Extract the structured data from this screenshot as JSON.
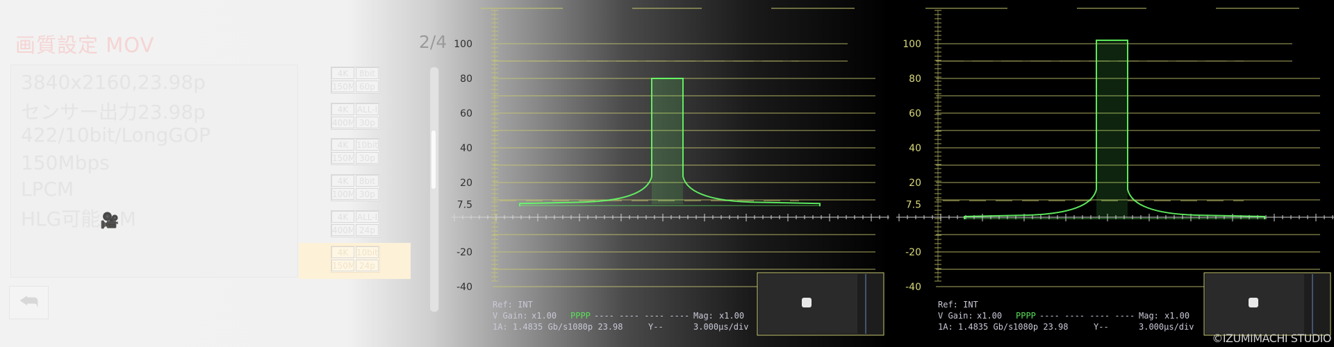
{
  "menu": {
    "title": "画質設定 MOV",
    "page_indicator": "2/4",
    "info_lines": [
      "3840x2160,23.98p",
      "センサー出力23.98p",
      "422/10bit/LongGOP",
      "150Mbps",
      "LPCM",
      "HLG可能"
    ],
    "info_icon": "movie-camera-icon",
    "info_icon_suffix": "M",
    "formats": [
      {
        "res": "4K",
        "spec": "8bit",
        "rate": "150M",
        "fps": "60p",
        "selected": false
      },
      {
        "res": "4K",
        "spec": "ALL-I",
        "rate": "400M",
        "fps": "30p",
        "selected": false
      },
      {
        "res": "4K",
        "spec": "10bit",
        "rate": "150M",
        "fps": "30p",
        "selected": false
      },
      {
        "res": "4K",
        "spec": "8bit",
        "rate": "100M",
        "fps": "30p",
        "selected": false
      },
      {
        "res": "4K",
        "spec": "ALL-I",
        "rate": "400M",
        "fps": "24p",
        "selected": false
      },
      {
        "res": "4K",
        "spec": "10bit",
        "rate": "150M",
        "fps": "24p",
        "selected": true
      }
    ],
    "back_icon": "return-arrow-icon",
    "selection_color": "#fdf1d8"
  },
  "scopes": [
    {
      "y_labels": [
        "100",
        "80",
        "60",
        "40",
        "20",
        "7.5",
        "-20",
        "-40"
      ],
      "label_color": "#2e2e2e",
      "waveform": {
        "pedestal": 7.5,
        "peak": 80
      },
      "ref": "Ref: INT",
      "vgain_label": "V Gain:",
      "vgain_value": "x1.00",
      "pattern": "PPPP",
      "pattern_dashes": "---- ---- ---- ----",
      "mag_label": "Mag:",
      "mag_value": "x1.00",
      "link": "1A: 1.4835 Gb/s",
      "format": "1080p 23.98",
      "y_label": "Y--",
      "timebase": "3.000µs/div"
    },
    {
      "y_labels": [
        "100",
        "80",
        "60",
        "40",
        "20",
        "7.5",
        "-20",
        "-40"
      ],
      "label_color": "#d8d878",
      "waveform": {
        "pedestal": 0,
        "peak": 102
      },
      "ref": "Ref: INT",
      "vgain_label": "V Gain:",
      "vgain_value": "x1.00",
      "pattern": "PPPP",
      "pattern_dashes": "---- ---- ---- ----",
      "mag_label": "Mag:",
      "mag_value": "x1.00",
      "link": "1A: 1.4835 Gb/s",
      "format": "1080p 23.98",
      "y_label": "Y--",
      "timebase": "3.000µs/div"
    }
  ],
  "copyright": "©IZUMIMACHI STUDIO",
  "colors": {
    "graticule": "#c9c970",
    "trace": "#66ff66",
    "scope_text": "#c9c9d8",
    "pattern": "#58e058"
  }
}
